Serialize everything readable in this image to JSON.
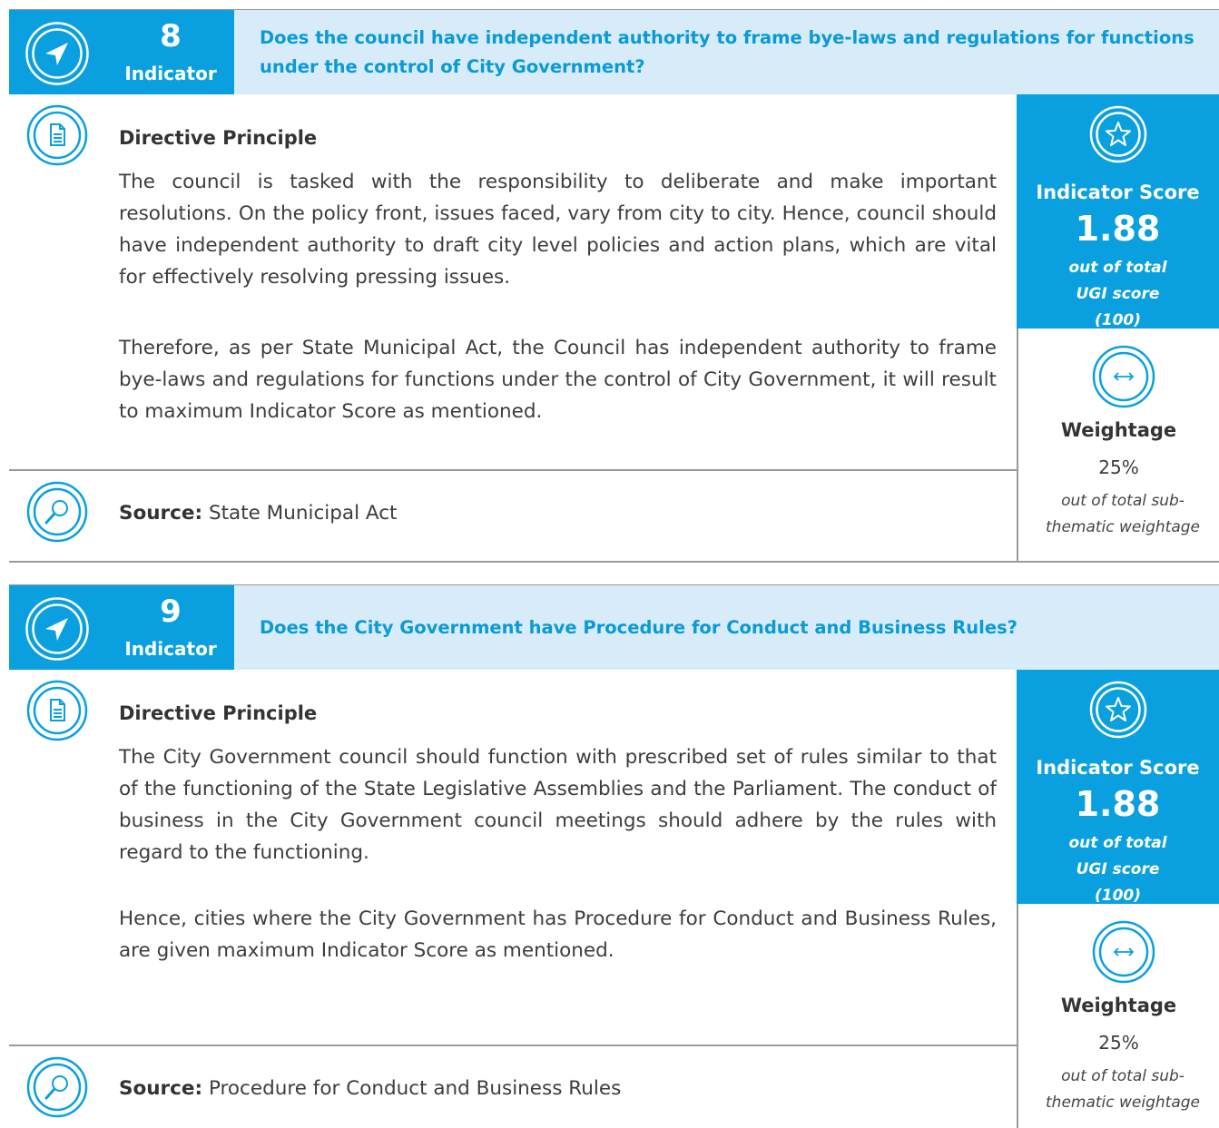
{
  "colors": {
    "accent": "#0aa0df",
    "header_bg": "#d7ecf8",
    "question_text": "#0a9ad6",
    "rule": "#9a9a9a"
  },
  "icons": {
    "header": "navigation-arrow-icon",
    "directive": "document-icon",
    "source": "magnifier-icon",
    "score": "star-icon",
    "weightage": "horizontal-arrows-icon"
  },
  "indicators": [
    {
      "number": "8",
      "label": "Indicator",
      "question": "Does the council have independent authority to frame bye-laws and regulations for functions under the control of City Government?",
      "directive_title": "Directive Principle",
      "directive_paragraphs": [
        "The council is tasked with the responsibility to deliberate and make important resolutions. On the policy front, issues faced, vary from city to city. Hence, council should have independent authority to draft city level policies and action plans, which are vital for effectively resolving pressing issues.",
        "Therefore, as per State Municipal Act, the Council has independent authority to frame bye-laws and regulations for functions under the control of City Government, it will result to maximum Indicator Score as mentioned."
      ],
      "source_label": "Source:",
      "source_text": "State Municipal Act",
      "score_label": "Indicator Score",
      "score_value": "1.88",
      "score_note": "out of total UGI score (100)",
      "weightage_label": "Weightage",
      "weightage_value": "25%",
      "weightage_note": "out of total sub-thematic weightage"
    },
    {
      "number": "9",
      "label": "Indicator",
      "question": "Does the City Government have Procedure for Conduct and Business Rules?",
      "directive_title": "Directive Principle",
      "directive_paragraphs": [
        "The City Government council should function with prescribed set of rules similar to that of the functioning of the State Legislative Assemblies and the Parliament. The conduct of business in the City Government council meetings should adhere by the rules with regard to the functioning.",
        "Hence, cities where the City Government has Procedure for Conduct and Business Rules, are given maximum Indicator Score as mentioned."
      ],
      "source_label": "Source:",
      "source_text": "Procedure for Conduct and Business Rules",
      "score_label": "Indicator Score",
      "score_value": "1.88",
      "score_note": "out of total UGI score (100)",
      "weightage_label": "Weightage",
      "weightage_value": "25%",
      "weightage_note": "out of total sub-thematic weightage"
    }
  ]
}
